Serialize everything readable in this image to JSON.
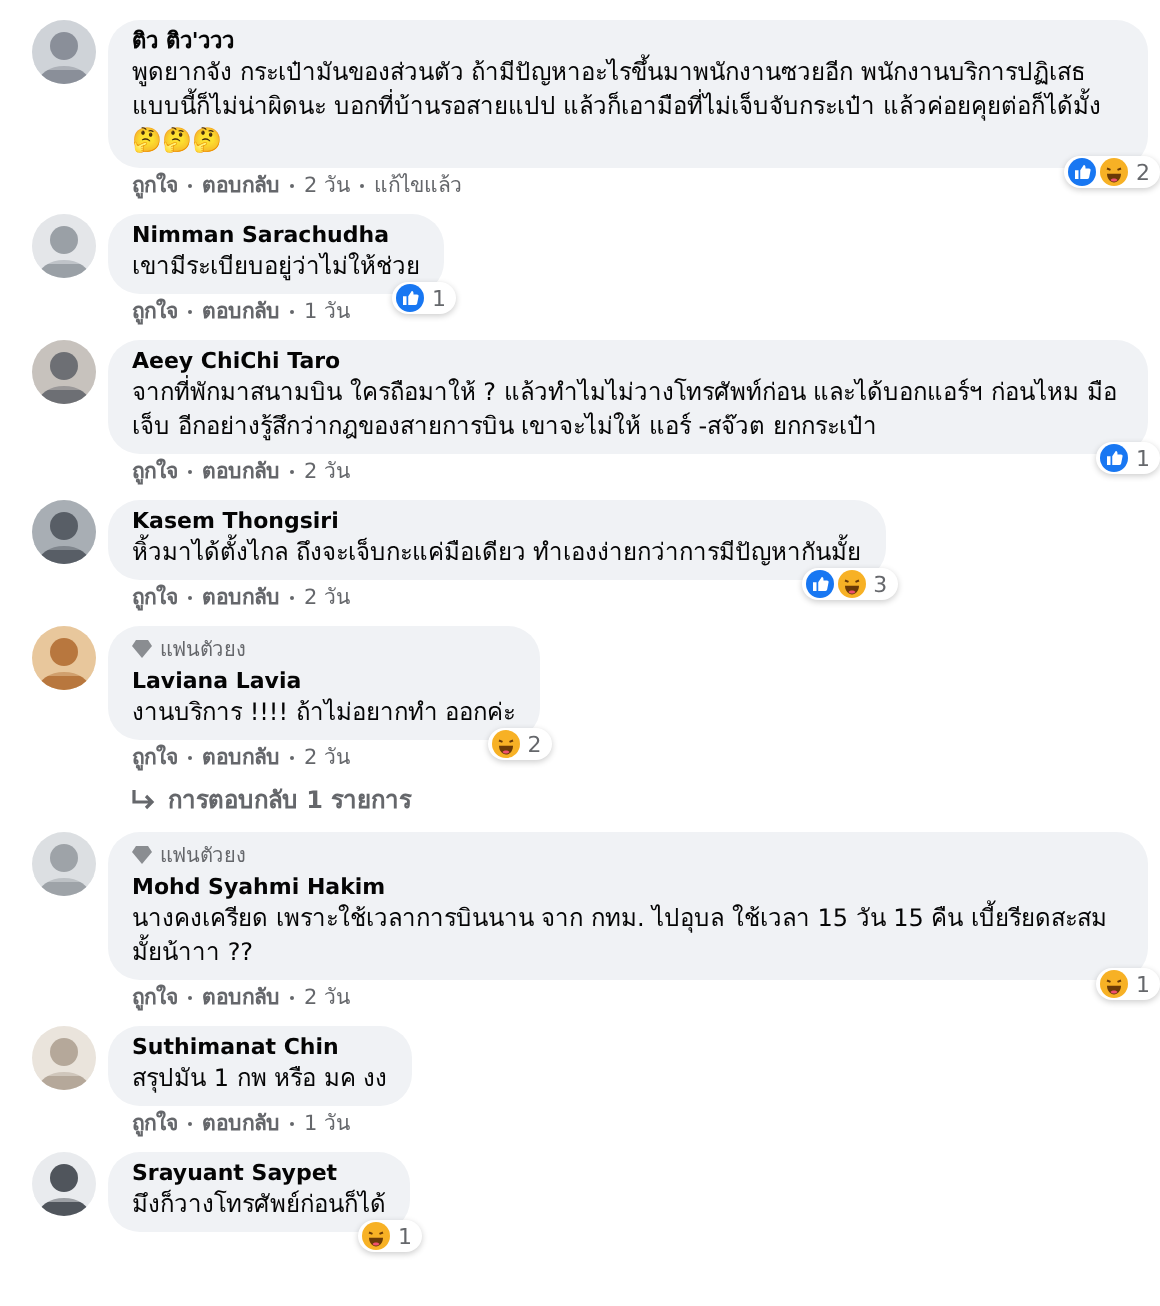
{
  "comments": [
    {
      "name": "ติว ติว'ววว",
      "text": "พูดยากจัง กระเป๋ามันของส่วนตัว ถ้ามีปัญหาอะไรขึ้นมาพนักงานซวยอีก พนักงานบริการปฏิเสธแบบนี้ก็ไม่น่าผิดนะ บอกที่บ้านรอสายแปป แล้วก็เอามือที่ไม่เจ็บจับกระเป๋า แล้วค่อยคุยต่อก็ได้มั้ง🤔🤔🤔",
      "reactions": [
        {
          "kind": "like"
        },
        {
          "kind": "haha"
        }
      ],
      "count": "2",
      "actions": [
        "ถูกใจ",
        "ตอบกลับ",
        "2 วัน",
        "แก้ไขแล้ว"
      ]
    },
    {
      "name": "Nimman Sarachudha",
      "text": "เขามีระเบียบอยู่ว่าไม่ให้ช่วย",
      "reactions": [
        {
          "kind": "like"
        }
      ],
      "count": "1",
      "actions": [
        "ถูกใจ",
        "ตอบกลับ",
        "1 วัน"
      ]
    },
    {
      "name": "Aeey ChiChi Taro",
      "text": "จากที่พักมาสนามบิน ใครถือมาให้ ? แล้วทำไมไม่วางโทรศัพท์ก่อน และได้บอกแอร์ฯ ก่อนไหม มือเจ็บ อีกอย่างรู้สึกว่ากฎของสายการบิน เขาจะไม่ให้ แอร์ -สจ๊วต ยกกระเป๋า",
      "reactions": [
        {
          "kind": "like"
        }
      ],
      "count": "1",
      "actions": [
        "ถูกใจ",
        "ตอบกลับ",
        "2 วัน"
      ]
    },
    {
      "name": "Kasem Thongsiri",
      "text": "หิ้วมาได้ตั้งไกล ถึงจะเจ็บกะแค่มือเดียว ทำเองง่ายกว่าการมีปัญหากันมั้ย",
      "reactions": [
        {
          "kind": "like"
        },
        {
          "kind": "haha"
        }
      ],
      "count": "3",
      "actions": [
        "ถูกใจ",
        "ตอบกลับ",
        "2 วัน"
      ]
    },
    {
      "name": "Laviana Lavia",
      "badge": "แฟนตัวยง",
      "text": "งานบริการ !!!! ถ้าไม่อยากทำ ออกค่ะ",
      "reactions": [
        {
          "kind": "haha"
        }
      ],
      "count": "2",
      "actions": [
        "ถูกใจ",
        "ตอบกลับ",
        "2 วัน"
      ],
      "replies": "การตอบกลับ 1 รายการ"
    },
    {
      "name": "Mohd Syahmi Hakim",
      "badge": "แฟนตัวยง",
      "text": "นางคงเครียด เพราะใช้เวลาการบินนาน จาก กทม. ไปอุบล ใช้เวลา 15 วัน 15 คืน เบี้ยรียดสะสมมั้ยน้าาา ??",
      "reactions": [
        {
          "kind": "haha"
        }
      ],
      "count": "1",
      "actions": [
        "ถูกใจ",
        "ตอบกลับ",
        "2 วัน"
      ]
    },
    {
      "name": "Suthimanat Chin",
      "text": "สรุปมัน 1 กพ หรือ มค งง",
      "actions": [
        "ถูกใจ",
        "ตอบกลับ",
        "1 วัน"
      ]
    },
    {
      "name": "Srayuant Saypet",
      "text": "มึงก็วางโทรศัพย์ก่อนก็ได้",
      "reactions": [
        {
          "kind": "haha"
        }
      ],
      "count": "1"
    }
  ]
}
